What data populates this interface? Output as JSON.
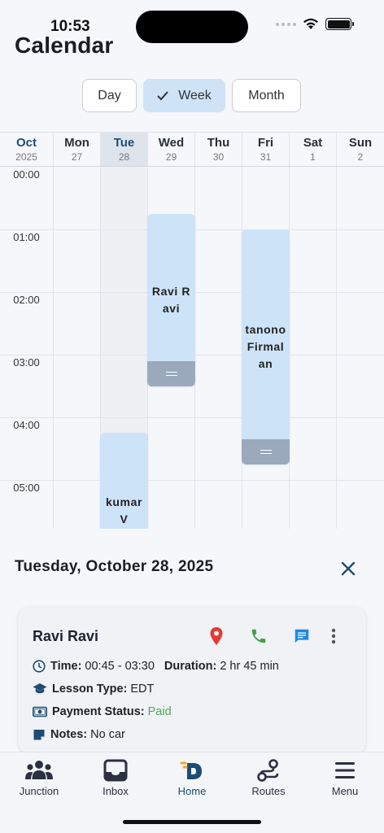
{
  "status": {
    "time": "10:53"
  },
  "app": {
    "title": "Calendar"
  },
  "view_switch": {
    "day": "Day",
    "week": "Week",
    "month": "Month",
    "selected": "Week"
  },
  "calendar": {
    "month": "Oct",
    "year": "2025",
    "days": [
      {
        "name": "Mon",
        "date": "27"
      },
      {
        "name": "Tue",
        "date": "28"
      },
      {
        "name": "Wed",
        "date": "29"
      },
      {
        "name": "Thu",
        "date": "30"
      },
      {
        "name": "Fri",
        "date": "31"
      },
      {
        "name": "Sat",
        "date": "1"
      },
      {
        "name": "Sun",
        "date": "2"
      }
    ],
    "hours": [
      "00:00",
      "01:00",
      "02:00",
      "03:00",
      "04:00",
      "05:00"
    ],
    "events": [
      {
        "name": "Ravi Ravi",
        "day": "Wed",
        "start": "00:45",
        "end": "03:30"
      },
      {
        "name": "tanono Firmalan",
        "day": "Fri",
        "start": "01:00",
        "end": "04:45"
      },
      {
        "name": "kumar V",
        "day": "Tue",
        "start": "04:15"
      }
    ]
  },
  "sheet": {
    "date": "Tuesday, October 28, 2025",
    "card": {
      "name": "Ravi Ravi",
      "time_label": "Time:",
      "time_value": "00:45 - 03:30",
      "duration_label": "Duration:",
      "duration_value": "2 hr 45 min",
      "lesson_label": "Lesson Type:",
      "lesson_value": "EDT",
      "payment_label": "Payment Status:",
      "payment_value": "Paid",
      "notes_label": "Notes:",
      "notes_value": "No car"
    }
  },
  "nav": {
    "junction": "Junction",
    "inbox": "Inbox",
    "home": "Home",
    "routes": "Routes",
    "menu": "Menu"
  },
  "colors": {
    "accent": "#1e4c73",
    "event": "#cde3f8",
    "paid": "#4cab55",
    "location": "#e53935",
    "phone": "#43a047",
    "message": "#1e88e5"
  }
}
